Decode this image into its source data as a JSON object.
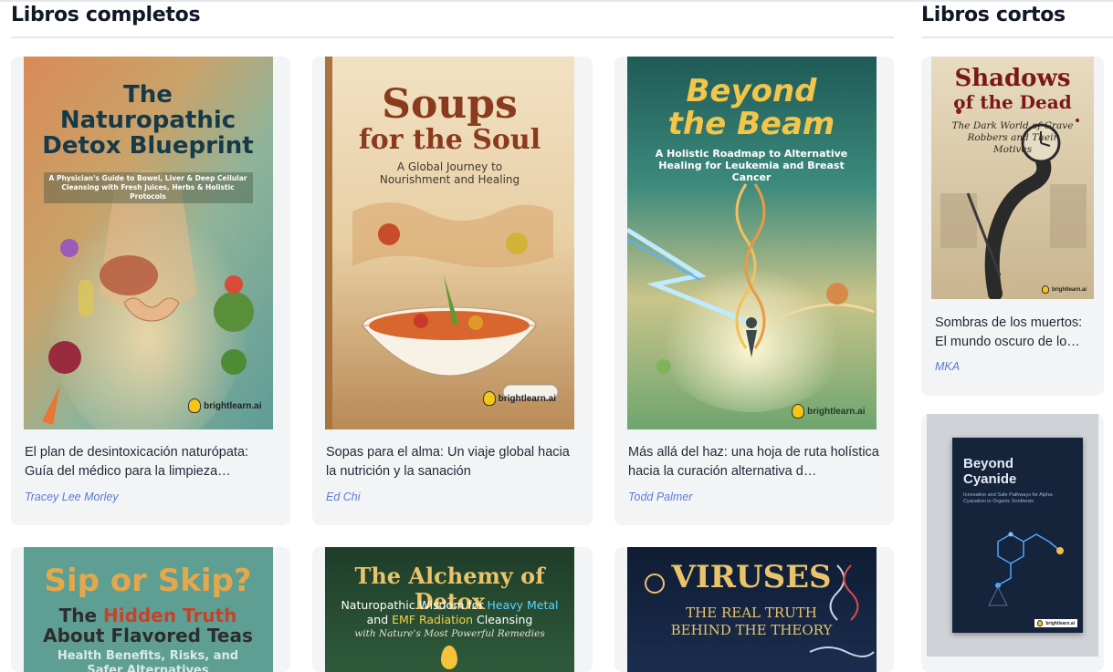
{
  "sections": {
    "full": "Libros completos",
    "short": "Libros cortos"
  },
  "full_books": [
    {
      "title": "El plan de desintoxicación naturópata: Guía del médico para la limpieza…",
      "author": "Tracey Lee Morley",
      "cover": {
        "line1": "The",
        "line2": "Naturopathic",
        "line3": "Detox Blueprint",
        "subtitle": "A Physician's Guide to Bowel, Liver & Deep Cellular Cleansing with Fresh Juices, Herbs & Holistic Protocols",
        "brand": "brightlearn.ai"
      }
    },
    {
      "title": "Sopas para el alma: Un viaje global hacia la nutrición y la sanación",
      "author": "Ed Chi",
      "cover": {
        "line1": "Soups",
        "line2": "for the Soul",
        "subtitle": "A Global Journey to Nourishment and Healing",
        "brand": "brightlearn.ai"
      }
    },
    {
      "title": "Más allá del haz: una hoja de ruta holística hacia la curación alternativa d…",
      "author": "Todd Palmer",
      "cover": {
        "line1": "Beyond",
        "line2": "the Beam",
        "subtitle": "A Holistic Roadmap to Alternative Healing for Leukemia and Breast Cancer",
        "brand": "brightlearn.ai"
      }
    },
    {
      "cover": {
        "line1": "Sip or Skip?",
        "line2a": "The ",
        "line2b": "Hidden Truth",
        "line3": "About Flavored Teas",
        "subtitle": "Health Benefits, Risks, and Safer Alternatives"
      }
    },
    {
      "cover": {
        "line1": "The Alchemy of Detox",
        "sub1a": "Naturopathic Wisdom for ",
        "sub1b": "Heavy Metal",
        "sub2a": "and ",
        "sub2b": "EMF Radiation",
        "sub2c": " Cleansing",
        "sub3": "with Nature's Most Powerful Remedies"
      }
    },
    {
      "cover": {
        "line1": "VIRUSES",
        "line2": "THE REAL TRUTH",
        "line3": "BEHIND THE THEORY"
      }
    }
  ],
  "short_books": [
    {
      "title": "Sombras de los muertos: El mundo oscuro de lo…",
      "author": "MKA",
      "cover": {
        "line1": "Shadows",
        "line2": "of the Dead",
        "subtitle": "The Dark World of Grave Robbers and Their Motives",
        "brand": "brightlearn.ai"
      }
    },
    {
      "cover": {
        "line1": "Beyond",
        "line2": "Cyanide",
        "subtitle": "Innovative and Safe Pathways for Alpha-Cyanation in Organic Sonthesis",
        "brand": "brightlearn.ai"
      }
    }
  ]
}
